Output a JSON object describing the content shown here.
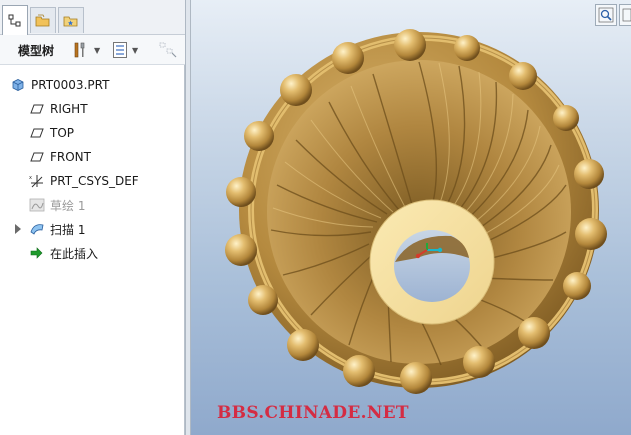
{
  "panel": {
    "toolbar_label": "模型树",
    "tree_items": [
      {
        "label": "PRT0003.PRT",
        "icon": "part-icon"
      },
      {
        "label": "RIGHT",
        "icon": "datum-plane-icon"
      },
      {
        "label": "TOP",
        "icon": "datum-plane-icon"
      },
      {
        "label": "FRONT",
        "icon": "datum-plane-icon"
      },
      {
        "label": "PRT_CSYS_DEF",
        "icon": "coordinate-system-icon"
      },
      {
        "label": "草绘 1",
        "icon": "sketch-icon",
        "suppressed": true
      },
      {
        "label": "扫描 1",
        "icon": "sweep-feature-icon",
        "expandable": true
      },
      {
        "label": "在此插入",
        "icon": "insert-here-arrow-icon"
      }
    ]
  },
  "viewport": {
    "watermark": "BBS.CHINADE.NET"
  },
  "colors": {
    "model_gold": "#c9a25a",
    "model_highlight": "#f3df9e",
    "ring_face": "#f6e4a0",
    "background_top": "#e7eef6",
    "background_bottom": "#8fa9cc",
    "watermark": "#d42c43"
  }
}
